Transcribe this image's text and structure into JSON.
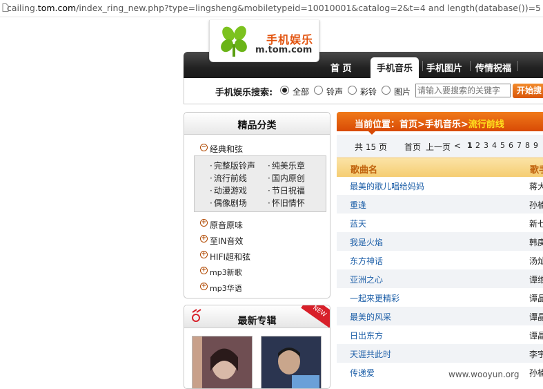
{
  "browser": {
    "url_prefix": "cailing.",
    "url_domain": "tom.com",
    "url_rest": "/index_ring_new.php?type=lingsheng&mobiletypeid=10010001&catalog=2&t=4 and length(database())=5"
  },
  "logo": {
    "cn": "手机娱乐",
    "en": "m.tom.com"
  },
  "nav": {
    "items": [
      "首  页",
      "手机音乐",
      "手机图片",
      "传情祝福"
    ],
    "active": "手机音乐"
  },
  "search": {
    "label": "手机娱乐搜索:",
    "options": [
      "全部",
      "铃声",
      "彩铃",
      "图片"
    ],
    "selected": "全部",
    "placeholder": "请输入要搜索的关键字",
    "button": "开始搜"
  },
  "categories": {
    "title": "精品分类",
    "expanded": {
      "label": "经典和弦",
      "sub": [
        "完整版铃声",
        "纯美乐章",
        "流行前线",
        "国内原创",
        "动漫游戏",
        "节日祝福",
        "偶像剧场",
        "怀旧情怀"
      ]
    },
    "others": [
      "原音原味",
      "至IN音效",
      "HIFI超和弦",
      "mp3新歌",
      "mp3华语"
    ]
  },
  "albums": {
    "title": "最新专辑",
    "badge": "NEW"
  },
  "breadcrumb": {
    "prefix": "当前位置：首页>手机音乐>",
    "current": "流行前线"
  },
  "pager": {
    "total_prefix": "共",
    "total": "15",
    "total_suffix": "页",
    "first": "首页",
    "prev": "上一页",
    "lt": "<",
    "pages": [
      "1",
      "2",
      "3",
      "4",
      "5",
      "6",
      "7",
      "8",
      "9"
    ],
    "current": "1"
  },
  "table": {
    "headers": {
      "song": "歌曲名",
      "singer": "歌手"
    },
    "rows": [
      {
        "song": "最美的歌儿唱给妈妈",
        "singer": "蒋大"
      },
      {
        "song": "重逢",
        "singer": "孙楠"
      },
      {
        "song": "蓝天",
        "singer": "新七"
      },
      {
        "song": "我是火焰",
        "singer": "韩庚"
      },
      {
        "song": "东方神话",
        "singer": "汤灿"
      },
      {
        "song": "亚洲之心",
        "singer": "谭维"
      },
      {
        "song": "一起来更精彩",
        "singer": "谭晶"
      },
      {
        "song": "最美的风采",
        "singer": "谭晶"
      },
      {
        "song": "日出东方",
        "singer": "谭晶"
      },
      {
        "song": "天涯共此时",
        "singer": "李宇"
      },
      {
        "song": "传递爱",
        "singer": "孙楠"
      }
    ]
  },
  "watermark": "www.wooyun.org",
  "colors": {
    "accent": "#e2530e",
    "link": "#1d5fa8",
    "nav_bg": "#222222",
    "header_gold": "#f5cd72"
  }
}
